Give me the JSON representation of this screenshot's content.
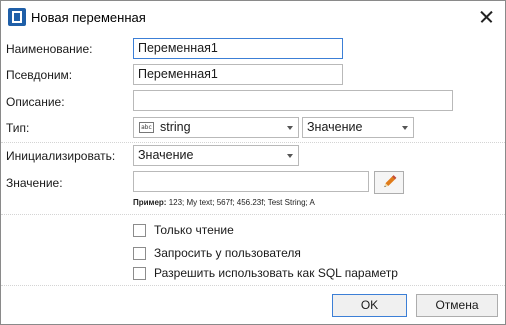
{
  "window": {
    "title": "Новая переменная"
  },
  "form": {
    "name": {
      "label": "Наименование:",
      "value": "Переменная1"
    },
    "alias": {
      "label": "Псевдоним:",
      "value": "Переменная1"
    },
    "description": {
      "label": "Описание:",
      "value": ""
    },
    "type": {
      "label": "Тип:",
      "icon": "abc-string-icon",
      "type_value": "string",
      "mode_value": "Значение"
    },
    "init": {
      "label": "Инициализировать:",
      "value": "Значение"
    },
    "value": {
      "label": "Значение:",
      "value": ""
    },
    "example": {
      "prefix": "Пример:",
      "text": " 123; My text; 567f; 456.23f; Test String; A"
    }
  },
  "options": [
    {
      "label": "Только чтение",
      "checked": false
    },
    {
      "label": "Запросить у пользователя",
      "checked": false
    },
    {
      "label": "Разрешить использовать как SQL параметр",
      "checked": false
    }
  ],
  "buttons": {
    "ok": "OK",
    "cancel": "Отмена"
  },
  "colors": {
    "accent": "#3c7fd6",
    "app_icon": "#1f5fa8",
    "pencil": "#e07b1a"
  }
}
